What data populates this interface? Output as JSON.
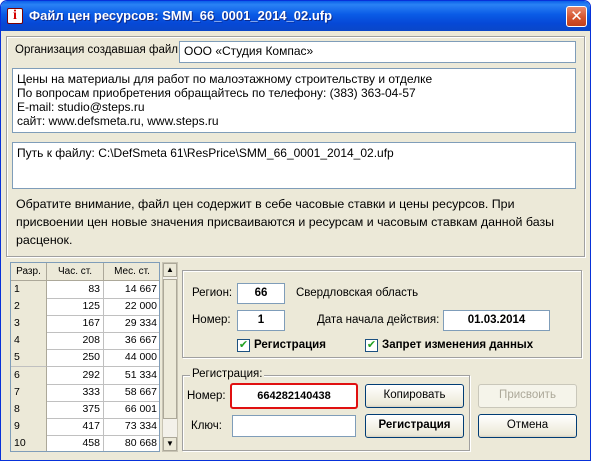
{
  "window": {
    "title": "Файл цен ресурсов: SMM_66_0001_2014_02.ufp",
    "app_icon": "info-icon",
    "app_icon_glyph": "i",
    "close_glyph": "✕"
  },
  "org": {
    "label": "Организация создавшая файл:",
    "value": "ООО «Студия Компас»"
  },
  "description": [
    "Цены на материалы для работ по малоэтажному строительству и отделке",
    "По вопросам приобретения обращайтесь по телефону: (383) 363-04-57",
    "E-mail: studio@steps.ru",
    "сайт: www.defsmeta.ru, www.steps.ru"
  ],
  "path": {
    "text": "Путь к файлу:  C:\\DefSmeta 61\\ResPrice\\SMM_66_0001_2014_02.ufp"
  },
  "notice": "Обратите внимание, файл цен содержит в себе часовые ставки и цены ресурсов. При присвоении цен новые значения присваиваются и ресурсам и часовым ставкам данной базы расценок.",
  "table": {
    "columns": [
      "Разр.",
      "Час. ст.",
      "Мес. ст."
    ],
    "rows": [
      [
        "1",
        "83",
        "14 667"
      ],
      [
        "2",
        "125",
        "22 000"
      ],
      [
        "3",
        "167",
        "29 334"
      ],
      [
        "4",
        "208",
        "36 667"
      ],
      [
        "5",
        "250",
        "44 000"
      ],
      [
        "6",
        "292",
        "51 334"
      ],
      [
        "7",
        "333",
        "58 667"
      ],
      [
        "8",
        "375",
        "66 001"
      ],
      [
        "9",
        "417",
        "73 334"
      ],
      [
        "10",
        "458",
        "80 668"
      ]
    ]
  },
  "scrollbar": {
    "up_glyph": "▲",
    "down_glyph": "▼"
  },
  "region": {
    "region_label": "Регион:",
    "region_value": "66",
    "region_name": "Свердловская область",
    "number_label": "Номер:",
    "number_value": "1",
    "date_label": "Дата начала действия:",
    "date_value": "01.03.2014",
    "checkbox_registration": "Регистрация",
    "checkbox_lock": "Запрет изменения данных",
    "check_glyph": "✔"
  },
  "registration": {
    "legend": "Регистрация:",
    "number_label": "Номер:",
    "number_value": "664282140438",
    "key_label": "Ключ:",
    "key_value": "",
    "copy_button": "Копировать",
    "register_button": "Регистрация"
  },
  "actions": {
    "assign_button": "Присвоить",
    "cancel_button": "Отмена"
  },
  "colors": {
    "titlebar": "#0a5be6",
    "highlight_border": "#e01010",
    "check": "#21a121"
  }
}
